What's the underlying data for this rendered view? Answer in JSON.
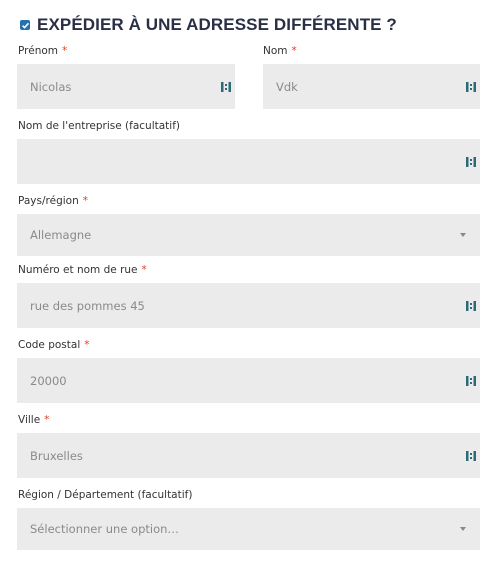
{
  "heading": {
    "checked": true,
    "text": "EXPÉDIER À UNE ADRESSE DIFFÉRENTE ?"
  },
  "required_mark": "*",
  "fields": {
    "first_name": {
      "label": "Prénom",
      "value": "Nicolas"
    },
    "last_name": {
      "label": "Nom",
      "value": "Vdk"
    },
    "company": {
      "label": "Nom de l'entreprise (facultatif)",
      "value": ""
    },
    "country": {
      "label": "Pays/région",
      "value": "Allemagne"
    },
    "street": {
      "label": "Numéro et nom de rue",
      "value": "rue des pommes 45"
    },
    "postcode": {
      "label": "Code postal",
      "value": "20000"
    },
    "city": {
      "label": "Ville",
      "value": "Bruxelles"
    },
    "region": {
      "label": "Région / Département (facultatif)",
      "placeholder": "Sélectionner une option…"
    }
  },
  "colors": {
    "accent": "#2271b1",
    "required": "#e2401c",
    "field_bg": "#ebebeb",
    "heading": "#2a2f45"
  }
}
